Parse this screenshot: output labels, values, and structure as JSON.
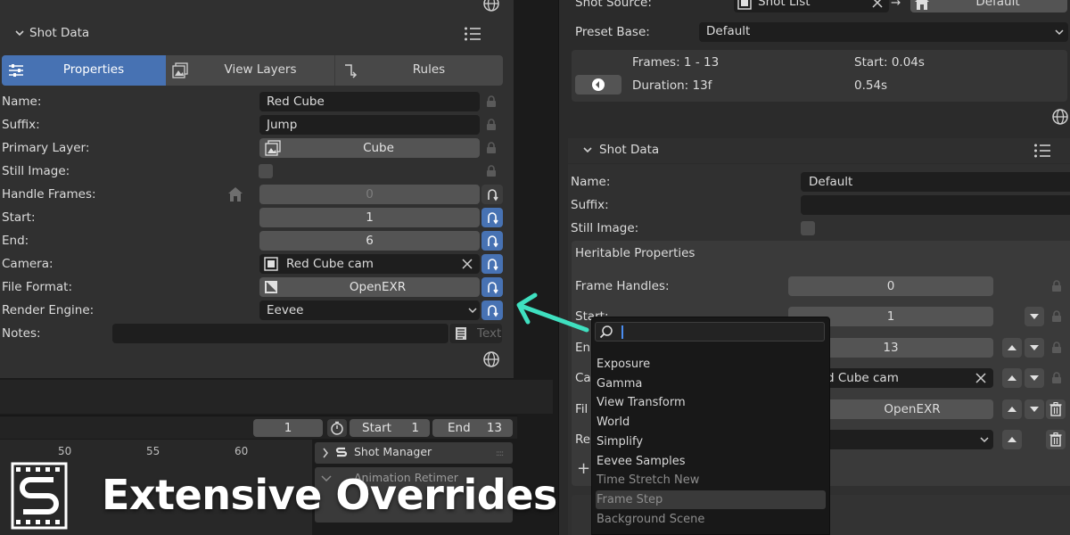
{
  "left_panel": {
    "header": {
      "title": "Shot Data"
    },
    "tabs": [
      {
        "label": "Properties",
        "active": true
      },
      {
        "label": "View Layers",
        "active": false
      },
      {
        "label": "Rules",
        "active": false
      }
    ],
    "fields": {
      "name": {
        "label": "Name:",
        "value": "Red Cube"
      },
      "suffix": {
        "label": "Suffix:",
        "value": "Jump"
      },
      "primary_layer": {
        "label": "Primary Layer:",
        "value": "Cube"
      },
      "still_image": {
        "label": "Still Image:"
      },
      "handle_frames": {
        "label": "Handle Frames:",
        "value": "0"
      },
      "start": {
        "label": "Start:",
        "value": "1"
      },
      "end": {
        "label": "End:",
        "value": "6"
      },
      "camera": {
        "label": "Camera:",
        "value": "Red Cube cam"
      },
      "file_format": {
        "label": "File Format:",
        "value": "OpenEXR"
      },
      "render_engine": {
        "label": "Render Engine:",
        "value": "Eevee"
      },
      "notes": {
        "label": "Notes:",
        "placeholder": "Text"
      }
    }
  },
  "timeline": {
    "current_frame": "1",
    "start_label": "Start",
    "start_value": "1",
    "end_label": "End",
    "end_value": "13",
    "ruler_ticks": [
      "50",
      "55",
      "60"
    ]
  },
  "bottom_panels": {
    "shot_manager": "Shot Manager",
    "animation_retimer": "Animation Retimer"
  },
  "banner": {
    "title": "Extensive Overrides"
  },
  "right_panel": {
    "shot_source": {
      "label": "Shot Source:",
      "list_value": "Shot List",
      "arrow": "→",
      "target_value": "Default"
    },
    "preset_base": {
      "label": "Preset Base:",
      "value": "Default"
    },
    "info": {
      "frames": "Frames: 1 - 13",
      "start_time": "Start: 0.04s",
      "duration": "Duration: 13f",
      "duration_time": "0.54s"
    },
    "shot_data_title": "Shot Data",
    "fields": {
      "name": {
        "label": "Name:",
        "value": "Default"
      },
      "suffix": {
        "label": "Suffix:",
        "value": ""
      },
      "still_image": {
        "label": "Still Image:"
      }
    },
    "heritable": {
      "title": "Heritable Properties",
      "frame_handles": {
        "label": "Frame Handles:",
        "value": "0"
      },
      "start": {
        "label": "Start:",
        "value": "1"
      },
      "end": {
        "label_fragment": "En",
        "value": "13"
      },
      "camera": {
        "label_fragment": "Ca",
        "value": "d Cube cam"
      },
      "file_format": {
        "label_fragment": "Fil",
        "value": "OpenEXR"
      },
      "render_engine": {
        "label_fragment": "Re"
      }
    }
  },
  "dropdown": {
    "search_value": "",
    "items": [
      {
        "label": "Exposure",
        "muted": false,
        "highlighted": false
      },
      {
        "label": "Gamma",
        "muted": false,
        "highlighted": false
      },
      {
        "label": "View Transform",
        "muted": false,
        "highlighted": false
      },
      {
        "label": "World",
        "muted": false,
        "highlighted": false
      },
      {
        "label": "Simplify",
        "muted": false,
        "highlighted": false
      },
      {
        "label": "Eevee Samples",
        "muted": false,
        "highlighted": false
      },
      {
        "label": "Time Stretch New",
        "muted": true,
        "highlighted": false
      },
      {
        "label": "Frame Step",
        "muted": true,
        "highlighted": true
      },
      {
        "label": "Background Scene",
        "muted": true,
        "highlighted": false
      }
    ]
  },
  "colors": {
    "accent_blue": "#4772b3",
    "arrow_teal": "#3fe0c0",
    "panel_bg": "#303030",
    "field_dark": "#1e1e1e",
    "field_gray": "#545454"
  }
}
